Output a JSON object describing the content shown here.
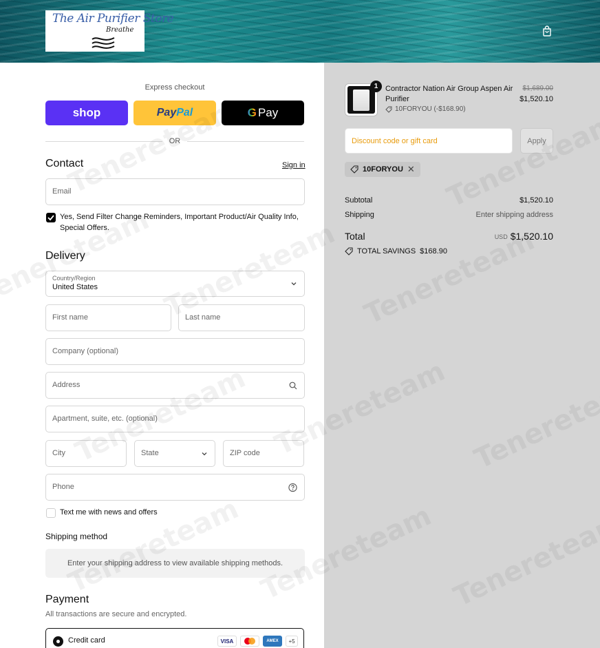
{
  "header": {
    "logo_title": "The Air Purifier Store",
    "logo_subtitle": "Breathe",
    "cart_icon": "shopping-bag-icon"
  },
  "express": {
    "label": "Express checkout",
    "shop_label": "shop",
    "paypal_label_1": "Pay",
    "paypal_label_2": "Pal",
    "gpay_g": "G",
    "gpay_label": "Pay",
    "or_text": "OR"
  },
  "contact": {
    "heading": "Contact",
    "sign_in": "Sign in",
    "email_placeholder": "Email",
    "reminders_label": "Yes, Send Filter Change Reminders, Important Product/Air Quality Info, Special Offers.",
    "reminders_checked": true
  },
  "delivery": {
    "heading": "Delivery",
    "country_label": "Country/Region",
    "country_value": "United States",
    "first_name": "First name",
    "last_name": "Last name",
    "company": "Company (optional)",
    "address": "Address",
    "apartment": "Apartment, suite, etc. (optional)",
    "city": "City",
    "state": "State",
    "zip": "ZIP code",
    "phone": "Phone",
    "text_offers_label": "Text me with news and offers",
    "text_offers_checked": false
  },
  "shipping_method": {
    "heading": "Shipping method",
    "message": "Enter your shipping address to view available shipping methods."
  },
  "payment": {
    "heading": "Payment",
    "subtitle": "All transactions are secure and encrypted.",
    "credit_card_label": "Credit card",
    "cards": [
      "VISA",
      "AMEX"
    ],
    "more_cards": "+5"
  },
  "summary": {
    "item": {
      "quantity": "1",
      "name": "Contractor Nation Air Group Aspen Air Purifier",
      "discount_line": "10FORYOU (-$168.90)",
      "original_price": "$1,689.00",
      "price": "$1,520.10"
    },
    "discount_placeholder": "Discount code or gift card",
    "apply_label": "Apply",
    "applied_code": "10FORYOU",
    "subtotal_label": "Subtotal",
    "subtotal_value": "$1,520.10",
    "shipping_label": "Shipping",
    "shipping_value": "Enter shipping address",
    "total_label": "Total",
    "currency": "USD",
    "total_value": "$1,520.10",
    "savings_label": "TOTAL SAVINGS",
    "savings_value": "$168.90"
  },
  "watermark": "Tenereteam",
  "colors": {
    "shop": "#5a31f4",
    "paypal": "#ffc439",
    "gpay": "#000000",
    "summary_bg": "#d5d5d5",
    "discount_placeholder": "#e89b0c"
  }
}
